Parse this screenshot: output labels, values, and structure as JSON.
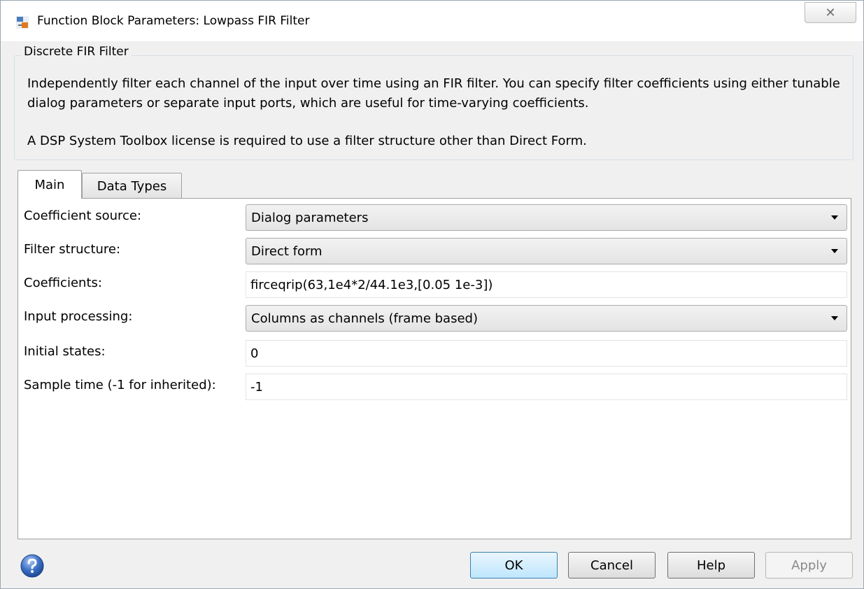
{
  "window": {
    "title": "Function Block Parameters: Lowpass FIR Filter",
    "close_glyph": "✕"
  },
  "group": {
    "legend": "Discrete FIR Filter",
    "description": "Independently filter each channel of the input over time using an FIR filter. You can specify filter coefficients using either tunable dialog parameters or separate input ports, which are useful for time-varying coefficients.",
    "license_note": "A DSP System Toolbox license is required to use a filter structure other than Direct Form."
  },
  "tabs": [
    {
      "label": "Main",
      "active": true
    },
    {
      "label": "Data Types",
      "active": false
    }
  ],
  "params": {
    "coefficient_source": {
      "label": "Coefficient source:",
      "value": "Dialog parameters"
    },
    "filter_structure": {
      "label": "Filter structure:",
      "value": "Direct form"
    },
    "coefficients": {
      "label": "Coefficients:",
      "value": "firceqrip(63,1e4*2/44.1e3,[0.05 1e-3])"
    },
    "input_processing": {
      "label": "Input processing:",
      "value": "Columns as channels (frame based)"
    },
    "initial_states": {
      "label": "Initial states:",
      "value": "0"
    },
    "sample_time": {
      "label": "Sample time (-1 for inherited):",
      "value": "-1"
    }
  },
  "buttons": {
    "ok": "OK",
    "cancel": "Cancel",
    "help": "Help",
    "apply": "Apply"
  },
  "icons": {
    "app": "simulink-block-icon",
    "help": "help-icon"
  },
  "colors": {
    "ok_border": "#3c7fb1",
    "help_icon_blue": "#3a6fc4"
  }
}
